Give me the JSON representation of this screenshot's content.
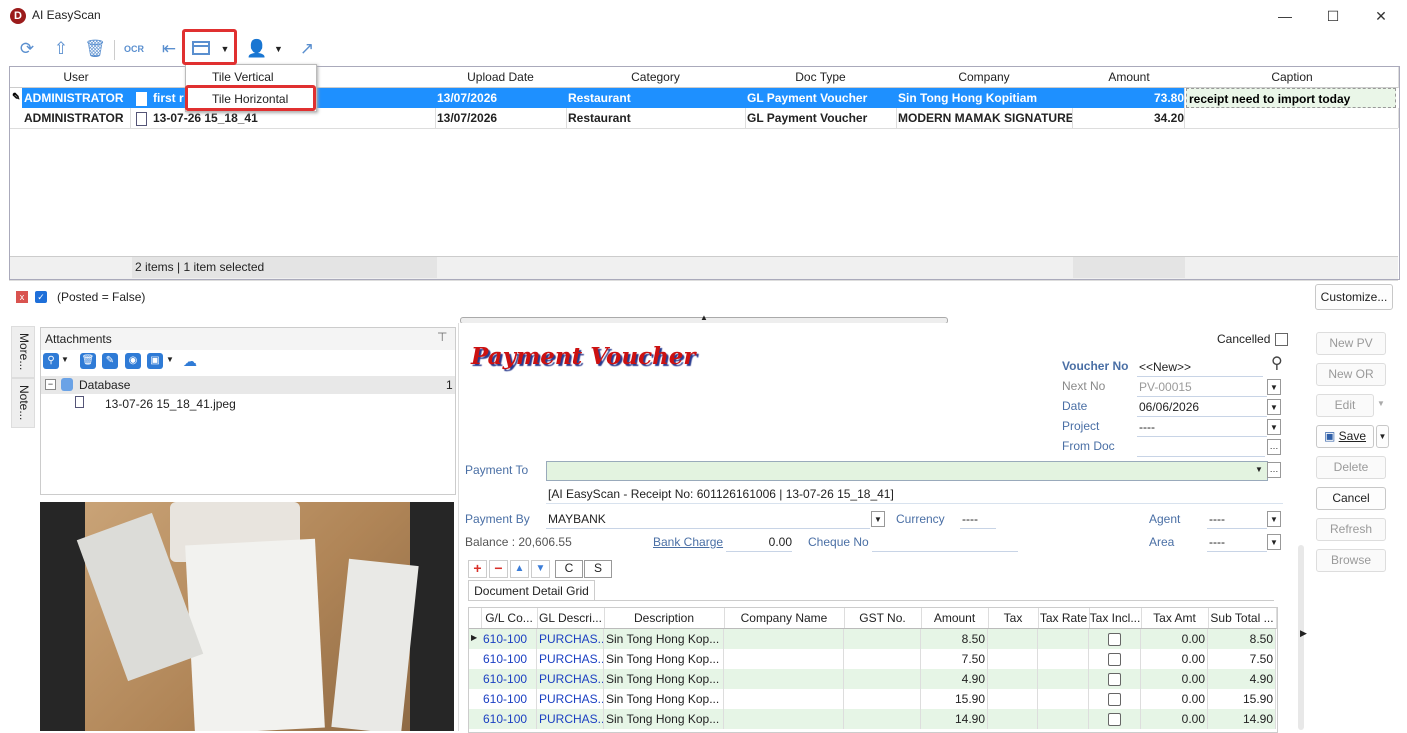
{
  "window": {
    "title": "AI EasyScan",
    "minimize": "—",
    "maximize": "☐",
    "close": "✕"
  },
  "toolbar": {
    "icons": [
      "refresh-icon",
      "upload-icon",
      "delete-icon",
      "ocr-icon",
      "panel-icon",
      "layout-icon",
      "user-icon",
      "share-icon"
    ],
    "ocr_label": "OCR"
  },
  "layout_menu": {
    "items": [
      "Tile Vertical",
      "Tile Horizontal"
    ]
  },
  "top_grid": {
    "columns": [
      "User",
      "",
      "Upload Date",
      "Category",
      "Doc Type",
      "Company",
      "Amount",
      "Caption"
    ],
    "rows": [
      {
        "user": "ADMINISTRATOR",
        "file": "first r",
        "upload_date": "13/07/2026",
        "category": "Restaurant",
        "doc_type": "GL Payment Voucher",
        "company": "Sin Tong Hong Kopitiam",
        "amount": "73.80",
        "caption": "receipt need to import today"
      },
      {
        "user": "ADMINISTRATOR",
        "file": "13-07-26 15_18_41",
        "upload_date": "13/07/2026",
        "category": "Restaurant",
        "doc_type": "GL Payment Voucher",
        "company": "MODERN MAMAK SIGNATURE",
        "amount": "34.20",
        "caption": ""
      }
    ],
    "footer": "2 items |  1 item selected"
  },
  "filter": {
    "text": "(Posted = False)",
    "customize": "Customize..."
  },
  "side_tabs": [
    "More...",
    "Note..."
  ],
  "attachments": {
    "title": "Attachments",
    "tree_root": "Database",
    "tree_count": "1",
    "file": "13-07-26 15_18_41.jpeg"
  },
  "voucher": {
    "cancelled_label": "Cancelled",
    "title": "Payment Voucher",
    "voucher_no_label": "Voucher No",
    "voucher_no": "<<New>>",
    "next_no_label": "Next No",
    "next_no": "PV-00015",
    "date_label": "Date",
    "date": "06/06/2026",
    "project_label": "Project",
    "project": "----",
    "from_doc_label": "From Doc",
    "payment_to_label": "Payment To",
    "payment_to_desc": "[AI EasyScan - Receipt No: 601126161006 | 13-07-26 15_18_41]",
    "payment_by_label": "Payment By",
    "payment_by": "MAYBANK",
    "currency_label": "Currency",
    "currency": "----",
    "agent_label": "Agent",
    "agent": "----",
    "balance": "Balance :  20,606.55",
    "bank_charge_label": "Bank Charge",
    "bank_charge": "0.00",
    "cheque_no_label": "Cheque No",
    "area_label": "Area",
    "area": "----",
    "btn_c": "C",
    "btn_s": "S",
    "detail_tab": "Document Detail Grid"
  },
  "detail_grid": {
    "columns": [
      "G/L Co...",
      "GL Descri...",
      "Description",
      "Company Name",
      "GST No.",
      "Amount",
      "Tax",
      "Tax Rate",
      "Tax Incl...",
      "Tax Amt",
      "Sub Total ..."
    ],
    "rows": [
      {
        "gl": "610-100",
        "gldesc": "PURCHAS...",
        "desc": "Sin Tong Hong Kop...",
        "amount": "8.50",
        "taxamt": "0.00",
        "sub": "8.50"
      },
      {
        "gl": "610-100",
        "gldesc": "PURCHAS...",
        "desc": "Sin Tong Hong Kop...",
        "amount": "7.50",
        "taxamt": "0.00",
        "sub": "7.50"
      },
      {
        "gl": "610-100",
        "gldesc": "PURCHAS...",
        "desc": "Sin Tong Hong Kop...",
        "amount": "4.90",
        "taxamt": "0.00",
        "sub": "4.90"
      },
      {
        "gl": "610-100",
        "gldesc": "PURCHAS...",
        "desc": "Sin Tong Hong Kop...",
        "amount": "15.90",
        "taxamt": "0.00",
        "sub": "15.90"
      },
      {
        "gl": "610-100",
        "gldesc": "PURCHAS...",
        "desc": "Sin Tong Hong Kop...",
        "amount": "14.90",
        "taxamt": "0.00",
        "sub": "14.90"
      }
    ]
  },
  "action_buttons": {
    "new_pv": "New PV",
    "new_or": "New OR",
    "edit": "Edit",
    "save": "Save",
    "delete": "Delete",
    "cancel": "Cancel",
    "refresh": "Refresh",
    "browse": "Browse"
  },
  "colors": {
    "selection": "#1e90ff",
    "highlight_red": "#e03030",
    "voucher_title": "#cc1111"
  }
}
